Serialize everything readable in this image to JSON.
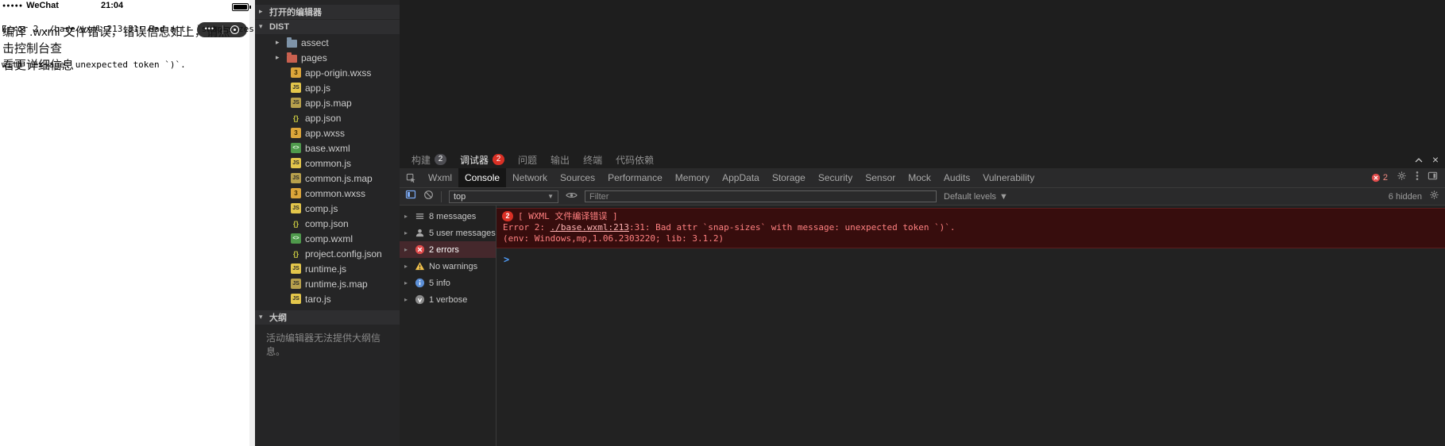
{
  "simulator": {
    "status_bar": {
      "carrier": "WeChat",
      "time": "21:04"
    },
    "error_text": {
      "line1": "Error 2 ./base.wxml:213:31: Bad attr `snap-sizes`",
      "line2": "with message: unexpected token `)`."
    },
    "compile_message": {
      "line1": "编译 .wxml 文件错误，错误信息如上，请点击控制台查",
      "line2": "看更详细信息"
    },
    "capsule": {
      "more": "•••"
    }
  },
  "explorer": {
    "open_editors_label": "打开的编辑器",
    "dist_label": "DIST",
    "outline_label": "大纲",
    "outline_message": "活动编辑器无法提供大纲信息。",
    "folders": [
      {
        "name": "assect",
        "color": "blue"
      },
      {
        "name": "pages",
        "color": "red"
      }
    ],
    "files": [
      {
        "name": "app-origin.wxss",
        "type": "wxss",
        "glyph": "3"
      },
      {
        "name": "app.js",
        "type": "js",
        "glyph": "JS"
      },
      {
        "name": "app.js.map",
        "type": "map",
        "glyph": "JS"
      },
      {
        "name": "app.json",
        "type": "json",
        "glyph": "{}"
      },
      {
        "name": "app.wxss",
        "type": "wxss",
        "glyph": "3"
      },
      {
        "name": "base.wxml",
        "type": "wxml",
        "glyph": "<>"
      },
      {
        "name": "common.js",
        "type": "js",
        "glyph": "JS"
      },
      {
        "name": "common.js.map",
        "type": "map",
        "glyph": "JS"
      },
      {
        "name": "common.wxss",
        "type": "wxss",
        "glyph": "3"
      },
      {
        "name": "comp.js",
        "type": "js",
        "glyph": "JS"
      },
      {
        "name": "comp.json",
        "type": "json",
        "glyph": "{}"
      },
      {
        "name": "comp.wxml",
        "type": "wxml",
        "glyph": "<>"
      },
      {
        "name": "project.config.json",
        "type": "json",
        "glyph": "{}"
      },
      {
        "name": "runtime.js",
        "type": "js",
        "glyph": "JS"
      },
      {
        "name": "runtime.js.map",
        "type": "map",
        "glyph": "JS"
      },
      {
        "name": "taro.js",
        "type": "js",
        "glyph": "JS"
      }
    ]
  },
  "panel_bar": {
    "tabs": [
      {
        "label": "构建",
        "badge": "2",
        "badge_color": "gray"
      },
      {
        "label": "调试器",
        "badge": "2",
        "badge_color": "red",
        "active": true
      },
      {
        "label": "问题"
      },
      {
        "label": "输出"
      },
      {
        "label": "终端"
      },
      {
        "label": "代码依赖"
      }
    ]
  },
  "devtools": {
    "tabs": [
      {
        "label": "Wxml"
      },
      {
        "label": "Console",
        "active": true
      },
      {
        "label": "Network"
      },
      {
        "label": "Sources"
      },
      {
        "label": "Performance"
      },
      {
        "label": "Memory"
      },
      {
        "label": "AppData"
      },
      {
        "label": "Storage"
      },
      {
        "label": "Security"
      },
      {
        "label": "Sensor"
      },
      {
        "label": "Mock"
      },
      {
        "label": "Audits"
      },
      {
        "label": "Vulnerability"
      }
    ],
    "error_count": "2",
    "toolbar": {
      "context": "top",
      "filter_placeholder": "Filter",
      "levels_label": "Default levels",
      "hidden_label": "6 hidden"
    },
    "sidebar": {
      "items": [
        {
          "label": "8 messages",
          "type": "list"
        },
        {
          "label": "5 user messages",
          "type": "user"
        },
        {
          "label": "2 errors",
          "type": "error",
          "selected": true
        },
        {
          "label": "No warnings",
          "type": "warning"
        },
        {
          "label": "5 info",
          "type": "info"
        },
        {
          "label": "1 verbose",
          "type": "verbose"
        }
      ]
    },
    "console": {
      "group_count": "2",
      "title": "[ WXML 文件编译错误 ]",
      "message_prefix": "Error 2: ",
      "message_link": "./base.wxml:213",
      "message_suffix": ":31: Bad attr `snap-sizes` with message: unexpected token `)`.",
      "env": "(env: Windows,mp,1.06.2303220; lib: 3.1.2)",
      "prompt": ">"
    }
  },
  "colors": {
    "error_bg": "#370d0d",
    "error_border": "#5a1d1d",
    "error_text": "#ff8080",
    "error_link": "#ffb3b3",
    "badge_red": "#d93025",
    "badge_gray": "#4d4d52",
    "sidebar_selected": "#45282c",
    "prompt_blue": "#4f9cf7"
  }
}
